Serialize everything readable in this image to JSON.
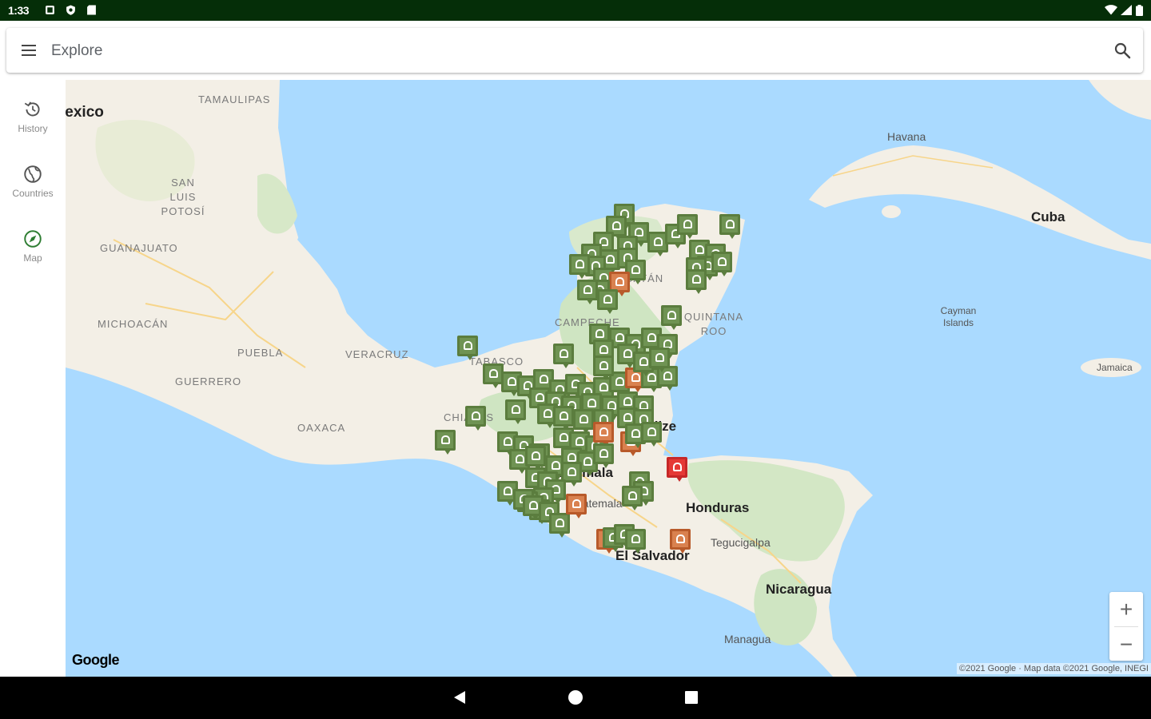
{
  "status_bar": {
    "time": "1:33",
    "left_icons": [
      "notification-icon",
      "shield-icon",
      "sd-card-icon"
    ],
    "right_icons": [
      "wifi-icon",
      "signal-icon",
      "battery-icon"
    ],
    "background": "#052e08"
  },
  "search_bar": {
    "title": "Explore",
    "menu_icon": "menu-icon",
    "search_icon": "search-icon"
  },
  "side_rail": {
    "items": [
      {
        "label": "History",
        "icon": "history-icon"
      },
      {
        "label": "Countries",
        "icon": "globe-icon"
      },
      {
        "label": "Map",
        "icon": "compass-icon"
      }
    ]
  },
  "map": {
    "labels": {
      "mexico": "lexico",
      "tamaulipas": "TAMAULIPAS",
      "san_luis_potosi": "SAN LUIS POTOSÍ",
      "guanajuato": "GUANAJUATO",
      "michoacan": "MICHOACÁN",
      "puebla": "PUEBLA",
      "veracruz": "VERACRUZ",
      "guerrero": "GUERRERO",
      "oaxaca": "OAXACA",
      "tabasco": "TABASCO",
      "chiapas": "CHIAPAS",
      "campeche": "CAMPECHE",
      "yucatan": "YUCATÁN",
      "quintana_roo": "QUINTANA ROO",
      "belize": "Belize",
      "guatemala": "Guatemala",
      "guatemala_city": "Guatemala",
      "honduras": "Honduras",
      "tegucigalpa": "Tegucigalpa",
      "el_salvador": "El Salvador",
      "nicaragua": "Nicaragua",
      "managua": "Managua",
      "havana": "Havana",
      "cuba": "Cuba",
      "cayman_islands": "Cayman Islands",
      "jamaica": "Jamaica"
    },
    "marker_colors": {
      "green": "#6f9353",
      "orange": "#d9814f",
      "red": "#e53935"
    },
    "zoom_in": "+",
    "zoom_out": "−",
    "google_logo": "Google",
    "copyright": "©2021 Google · Map data ©2021 Google, INEGI"
  },
  "nav_bar": {
    "buttons": [
      "back-icon",
      "home-icon",
      "recents-icon"
    ]
  }
}
